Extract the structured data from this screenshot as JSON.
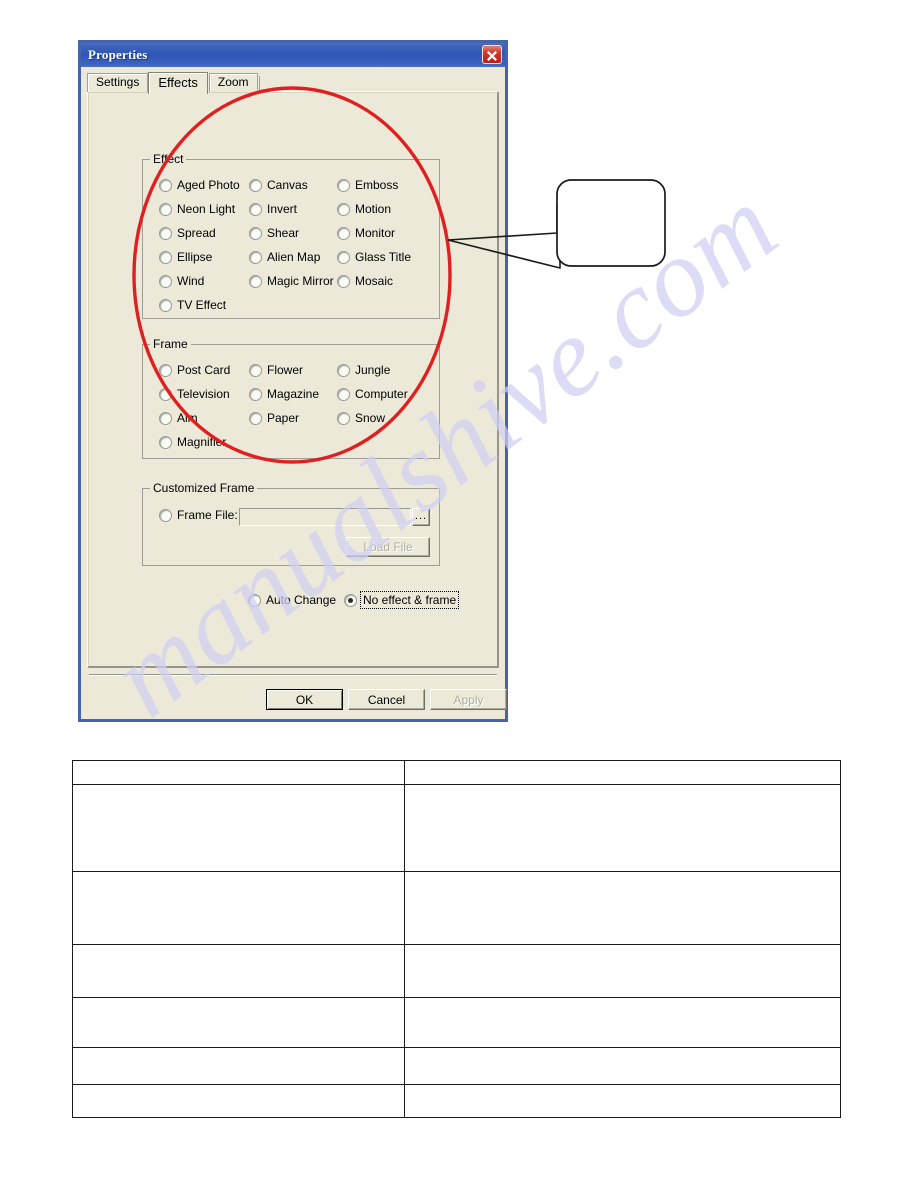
{
  "page": {
    "watermark": "manualshive.com"
  },
  "dialog": {
    "title": "Properties",
    "close_label": "×",
    "tabs": [
      {
        "id": "settings",
        "label": "Settings",
        "selected": false
      },
      {
        "id": "effects",
        "label": "Effects",
        "selected": true
      },
      {
        "id": "zoom",
        "label": "Zoom",
        "selected": false
      }
    ],
    "effect_group": {
      "legend": "Effect",
      "options": [
        {
          "label": "Aged Photo",
          "checked": false
        },
        {
          "label": "Canvas",
          "checked": false
        },
        {
          "label": "Emboss",
          "checked": false
        },
        {
          "label": "Neon Light",
          "checked": false
        },
        {
          "label": "Invert",
          "checked": false
        },
        {
          "label": "Motion",
          "checked": false
        },
        {
          "label": "Spread",
          "checked": false
        },
        {
          "label": "Shear",
          "checked": false
        },
        {
          "label": "Monitor",
          "checked": false
        },
        {
          "label": "Ellipse",
          "checked": false
        },
        {
          "label": "Alien Map",
          "checked": false
        },
        {
          "label": "Glass Title",
          "checked": false
        },
        {
          "label": "Wind",
          "checked": false
        },
        {
          "label": "Magic Mirror",
          "checked": false
        },
        {
          "label": "Mosaic",
          "checked": false
        },
        {
          "label": "TV Effect",
          "checked": false
        }
      ]
    },
    "frame_group": {
      "legend": "Frame",
      "options": [
        {
          "label": "Post Card",
          "checked": false
        },
        {
          "label": "Flower",
          "checked": false
        },
        {
          "label": "Jungle",
          "checked": false
        },
        {
          "label": "Television",
          "checked": false
        },
        {
          "label": "Magazine",
          "checked": false
        },
        {
          "label": "Computer",
          "checked": false
        },
        {
          "label": "Aim",
          "checked": false
        },
        {
          "label": "Paper",
          "checked": false
        },
        {
          "label": "Snow",
          "checked": false
        },
        {
          "label": "Magnifier",
          "checked": false
        }
      ]
    },
    "customized_frame": {
      "legend": "Customized Frame",
      "frame_file_label": "Frame File:",
      "frame_file_checked": false,
      "frame_file_value": "",
      "frame_file_placeholder": "",
      "browse_label": "...",
      "load_file_label": "Load File",
      "load_file_enabled": false
    },
    "mode_options": [
      {
        "label": "Auto Change",
        "checked": false,
        "focused": false
      },
      {
        "label": "No effect & frame",
        "checked": true,
        "focused": true
      }
    ],
    "buttons": [
      {
        "id": "ok",
        "label": "OK",
        "enabled": true,
        "default": true
      },
      {
        "id": "cancel",
        "label": "Cancel",
        "enabled": true,
        "default": false
      },
      {
        "id": "apply",
        "label": "Apply",
        "enabled": false,
        "default": false
      }
    ]
  },
  "annotations": {
    "ellipse_color": "#e02020",
    "callout_border_color": "#1a1a1a",
    "callout_text": ""
  },
  "bottom_table": {
    "columns": [
      "",
      ""
    ],
    "rows": [
      [
        "",
        ""
      ],
      [
        "",
        ""
      ],
      [
        "",
        ""
      ],
      [
        "",
        ""
      ],
      [
        "",
        ""
      ],
      [
        "",
        ""
      ],
      [
        "",
        ""
      ]
    ]
  }
}
